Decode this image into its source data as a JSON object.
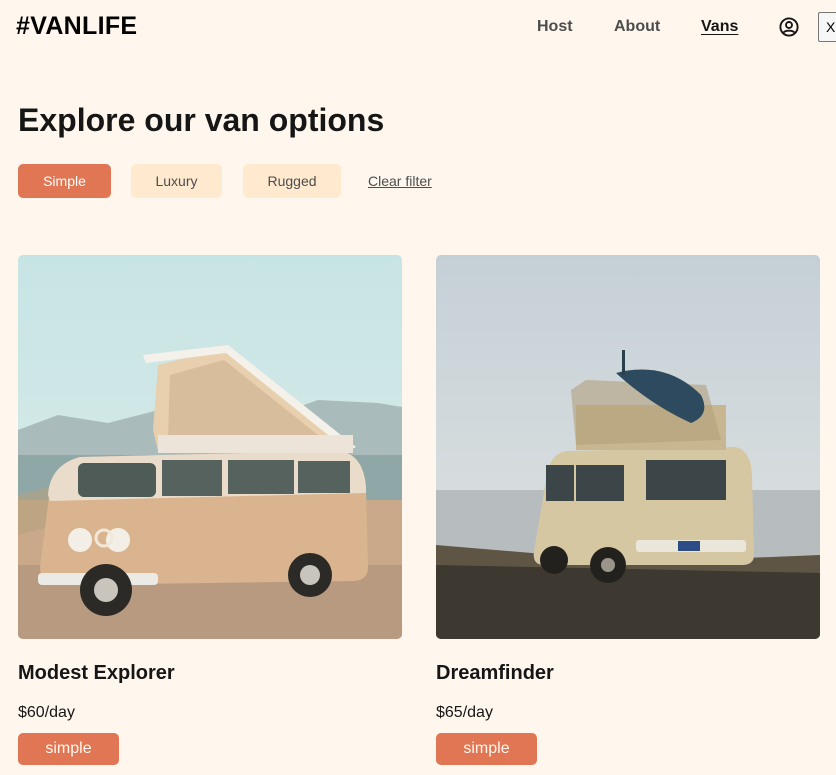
{
  "header": {
    "logo": "#VANLIFE",
    "nav": {
      "host": "Host",
      "about": "About",
      "vans": "Vans"
    },
    "user_icon": "user-circle-icon",
    "close_label": "X"
  },
  "page_title": "Explore our van options",
  "filters": {
    "simple": "Simple",
    "luxury": "Luxury",
    "rugged": "Rugged",
    "clear": "Clear filter",
    "active": "simple"
  },
  "vans": [
    {
      "name": "Modest Explorer",
      "price": "$60/day",
      "type": "simple"
    },
    {
      "name": "Dreamfinder",
      "price": "$65/day",
      "type": "simple"
    }
  ],
  "colors": {
    "background": "#fff7ed",
    "accent": "#e17654",
    "filter_bg": "#ffead0",
    "text": "#161616",
    "muted": "#4d4d4d"
  }
}
